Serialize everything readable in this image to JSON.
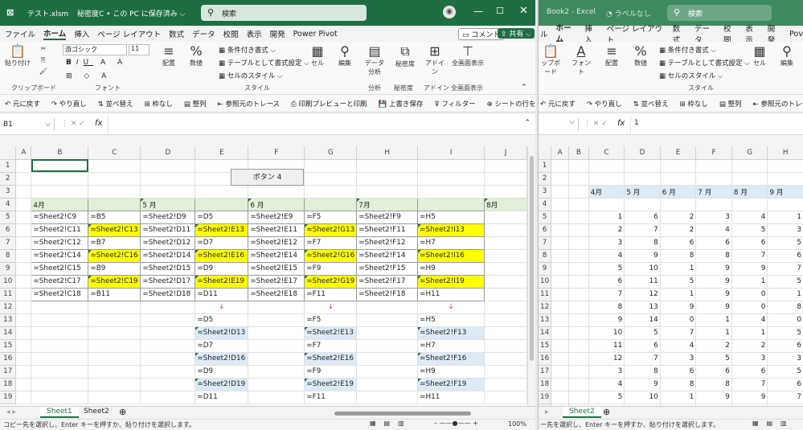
{
  "left": {
    "title": {
      "file": "テスト.xlsm",
      "sens": "秘密度C • この PC に保存済み ⌵",
      "search": "検索"
    },
    "menu": [
      "ファイル",
      "ホーム",
      "挿入",
      "ページ レイアウト",
      "数式",
      "データ",
      "校閲",
      "表示",
      "開発",
      "Power Pivot"
    ],
    "comment_btn": "コメント",
    "share_btn": "共有",
    "ribbon": {
      "paste": "貼り付け",
      "clipboard": "クリップボード",
      "font_name": "游ゴシック",
      "font_size": "11",
      "font": "フォント",
      "align": "配置",
      "number": "数値",
      "pct": "%",
      "cf": "条件付き書式",
      "tbl": "テーブルとして書式設定",
      "cellstyle": "セルのスタイル",
      "style": "スタイル",
      "cell": "セル",
      "edit": "編集",
      "analyze": "データ分析",
      "analyze_grp": "分析",
      "sens": "秘密度",
      "sens_grp": "秘密度",
      "addin": "アドイン",
      "addin_grp": "アドイン",
      "fullscreen": "全画面表示",
      "fullscreen_grp": "全画面表示"
    },
    "qat": [
      "元に戻す",
      "やり直し",
      "並べ替え",
      "枠なし",
      "整列",
      "参照元のトレース",
      "印刷プレビューと印刷",
      "上書き保存",
      "フィルター",
      "シートの行を挿入"
    ],
    "namebox": "B1",
    "fx": "fx",
    "formula": "",
    "button4": "ボタン 4",
    "cols": [
      "A",
      "B",
      "C",
      "D",
      "E",
      "F",
      "G",
      "H",
      "I",
      "J"
    ],
    "rows": [
      [
        "",
        "",
        "",
        "",
        "",
        "",
        "",
        "",
        "",
        ""
      ],
      [
        "",
        "",
        "",
        "",
        "",
        "",
        "",
        "",
        "",
        ""
      ],
      [
        "",
        "",
        "",
        "",
        "",
        "",
        "",
        "",
        "",
        ""
      ],
      [
        "",
        "4月",
        "",
        "5 月",
        "",
        "6 月",
        "",
        "7月",
        "",
        "8月"
      ],
      [
        "",
        "=Sheet2!C9",
        "=B5",
        "=Sheet2!D9",
        "=D5",
        "=Sheet2!E9",
        "=F5",
        "=Sheet2!F9",
        "=H5",
        ""
      ],
      [
        "",
        "=Sheet2!C11",
        "=Sheet2!C13",
        "=Sheet2!D11",
        "=Sheet2!E13",
        "=Sheet2!E11",
        "=Sheet2!G13",
        "=Sheet2!F11",
        "=Sheet2!I13",
        ""
      ],
      [
        "",
        "=Sheet2!C12",
        "=B7",
        "=Sheet2!D12",
        "=D7",
        "=Sheet2!E12",
        "=F7",
        "=Sheet2!F12",
        "=H7",
        ""
      ],
      [
        "",
        "=Sheet2!C14",
        "=Sheet2!C16",
        "=Sheet2!D14",
        "=Sheet2!E16",
        "=Sheet2!E14",
        "=Sheet2!G16",
        "=Sheet2!F14",
        "=Sheet2!I16",
        ""
      ],
      [
        "",
        "=Sheet2!C15",
        "=B9",
        "=Sheet2!D15",
        "=D9",
        "=Sheet2!E15",
        "=F9",
        "=Sheet2!F15",
        "=H9",
        ""
      ],
      [
        "",
        "=Sheet2!C17",
        "=Sheet2!C19",
        "=Sheet2!D17",
        "=Sheet2!E19",
        "=Sheet2!E17",
        "=Sheet2!G19",
        "=Sheet2!F17",
        "=Sheet2!I19",
        ""
      ],
      [
        "",
        "=Sheet2!C18",
        "=B11",
        "=Sheet2!D18",
        "=D11",
        "=Sheet2!E18",
        "=F11",
        "=Sheet2!F18",
        "=H11",
        ""
      ],
      [
        "",
        "",
        "",
        "",
        "↓",
        "",
        "↓",
        "",
        "↓",
        ""
      ],
      [
        "",
        "",
        "",
        "",
        "=D5",
        "",
        "=F5",
        "",
        "=H5",
        ""
      ],
      [
        "",
        "",
        "",
        "",
        "=Sheet2!D13",
        "",
        "=Sheet2!E13",
        "",
        "=Sheet2!F13",
        ""
      ],
      [
        "",
        "",
        "",
        "",
        "=D7",
        "",
        "=F7",
        "",
        "=H7",
        ""
      ],
      [
        "",
        "",
        "",
        "",
        "=Sheet2!D16",
        "",
        "=Sheet2!E16",
        "",
        "=Sheet2!F16",
        ""
      ],
      [
        "",
        "",
        "",
        "",
        "=D9",
        "",
        "=F9",
        "",
        "=H9",
        ""
      ],
      [
        "",
        "",
        "",
        "",
        "=Sheet2!D19",
        "",
        "=Sheet2!E19",
        "",
        "=Sheet2!F19",
        ""
      ],
      [
        "",
        "",
        "",
        "",
        "=D11",
        "",
        "=F11",
        "",
        "=H11",
        ""
      ]
    ],
    "sheets": [
      "Sheet1",
      "Sheet2"
    ],
    "status": "コピー先を選択し、Enter キーを押すか、貼り付けを選択します。",
    "zoom": "100%"
  },
  "right": {
    "title": {
      "file": "Book2 - Excel",
      "label": "ラベルなし",
      "search": "検索"
    },
    "menu": [
      "ル",
      "ホーム",
      "挿入",
      "ページ レイアウト",
      "数式",
      "データ",
      "校閲",
      "表示",
      "開発",
      "Pov"
    ],
    "ribbon": {
      "paste": "ップボード",
      "font": "フォント",
      "align": "配置",
      "number": "数値",
      "cf": "条件付き書式",
      "tbl": "テーブルとして書式設定",
      "cellstyle": "セルのスタイル",
      "style": "スタイル",
      "cell": "セル",
      "edit": "編集"
    },
    "qat": [
      "元に戻す",
      "やり直し",
      "並べ替え",
      "枠なし",
      "整列",
      "参照元のトレース"
    ],
    "namebox": "",
    "formula": "1",
    "cols": [
      "A",
      "B",
      "C",
      "D",
      "E",
      "F",
      "G",
      "H"
    ],
    "rows": [
      [
        "",
        "",
        "",
        "",
        "",
        "",
        "",
        ""
      ],
      [
        "",
        "",
        "",
        "",
        "",
        "",
        "",
        ""
      ],
      [
        "",
        "",
        "4月",
        "5 月",
        "6 月",
        "7 月",
        "8 月",
        "9 月"
      ],
      [
        "",
        "",
        "",
        "",
        "",
        "",
        "",
        ""
      ],
      [
        "",
        "",
        "1",
        "6",
        "2",
        "3",
        "4",
        "1"
      ],
      [
        "",
        "",
        "2",
        "7",
        "2",
        "4",
        "5",
        "3"
      ],
      [
        "",
        "",
        "3",
        "8",
        "6",
        "6",
        "6",
        "5"
      ],
      [
        "",
        "",
        "4",
        "9",
        "8",
        "8",
        "7",
        "6"
      ],
      [
        "",
        "",
        "5",
        "10",
        "1",
        "9",
        "9",
        "7"
      ],
      [
        "",
        "",
        "6",
        "11",
        "5",
        "9",
        "1",
        "5"
      ],
      [
        "",
        "",
        "7",
        "12",
        "1",
        "9",
        "0",
        "1"
      ],
      [
        "",
        "",
        "8",
        "13",
        "9",
        "9",
        "0",
        "8"
      ],
      [
        "",
        "",
        "9",
        "14",
        "0",
        "1",
        "4",
        "0"
      ],
      [
        "",
        "",
        "10",
        "5",
        "7",
        "1",
        "1",
        "5"
      ],
      [
        "",
        "",
        "11",
        "6",
        "4",
        "2",
        "2",
        "6"
      ],
      [
        "",
        "",
        "12",
        "7",
        "3",
        "5",
        "3",
        "3"
      ],
      [
        "",
        "",
        "3",
        "8",
        "6",
        "6",
        "6",
        "5"
      ],
      [
        "",
        "",
        "4",
        "9",
        "8",
        "8",
        "7",
        "6"
      ],
      [
        "",
        "",
        "5",
        "10",
        "1",
        "9",
        "9",
        "7"
      ],
      [
        "",
        "",
        "6",
        "11",
        "5",
        "9",
        "1",
        "5"
      ]
    ],
    "sheets": [
      "Sheet2"
    ],
    "status": "ー先を選択し、Enter キーを押すか、貼り付けを選択します。"
  },
  "colors": {
    "excel_green": "#1f6e43",
    "yellow": "#ffff00",
    "light_blue": "#ddebf7",
    "light_green": "#e2efd9"
  }
}
